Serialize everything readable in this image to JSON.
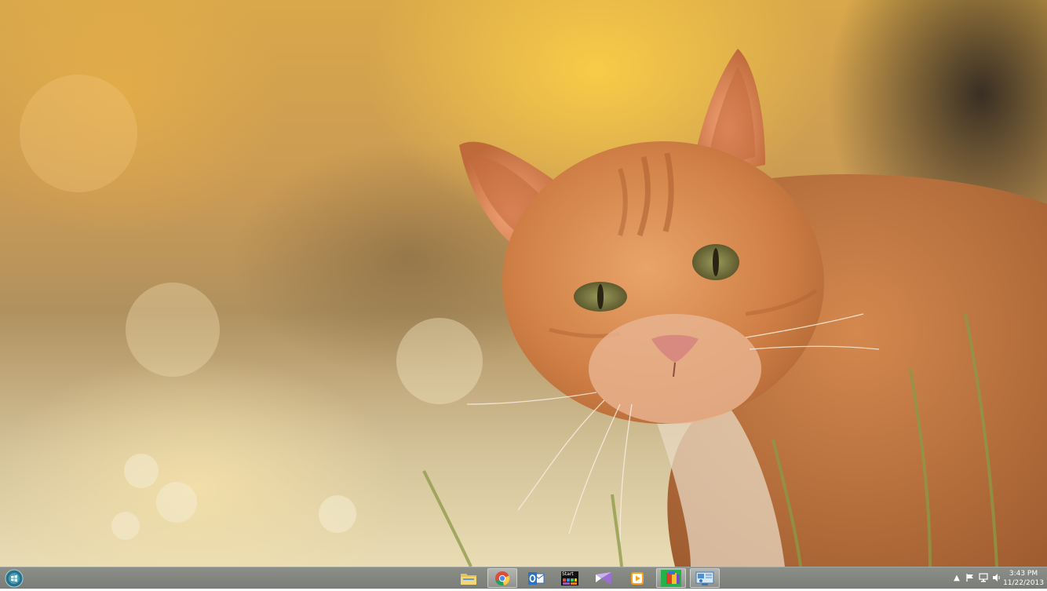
{
  "wallpaper": {
    "subject": "orange tabby cat"
  },
  "taskbar": {
    "start_icon": "windows-start-orb",
    "apps": [
      {
        "icon": "file-explorer-icon",
        "active": false
      },
      {
        "icon": "chrome-icon",
        "active": true
      },
      {
        "icon": "outlook-icon",
        "active": false
      },
      {
        "icon": "start-screen-app-icon",
        "label": "Start",
        "active": false
      },
      {
        "icon": "visual-studio-icon",
        "active": false
      },
      {
        "icon": "media-player-icon",
        "active": false
      },
      {
        "icon": "installer-box-icon",
        "active": false
      },
      {
        "icon": "remote-desktop-icon",
        "active": true
      }
    ],
    "tray_icons": [
      "show-hidden-icons-chevron",
      "action-center-flag-icon",
      "network-icon",
      "volume-icon"
    ],
    "clock": {
      "time": "3:43 PM",
      "date": "11/22/2013"
    }
  }
}
